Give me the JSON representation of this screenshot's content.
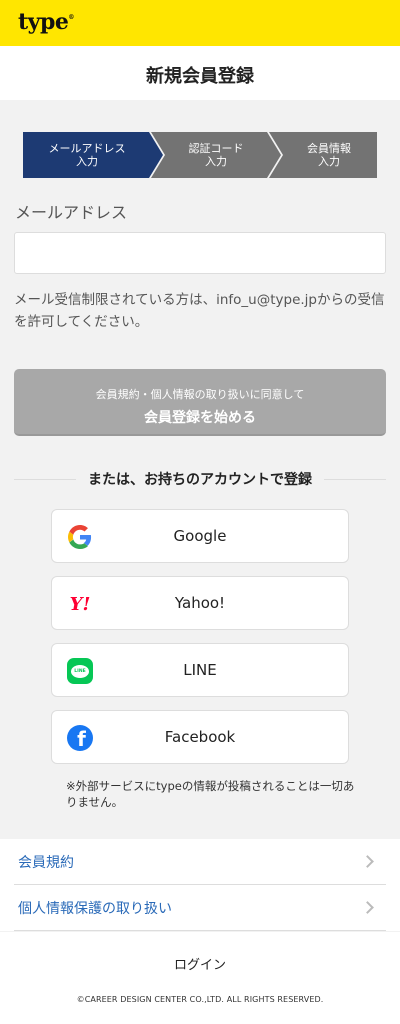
{
  "header": {
    "logo": "type",
    "logo_mark": "®"
  },
  "page": {
    "title": "新規会員登録"
  },
  "steps": [
    {
      "label": "メールアドレス\n入力",
      "active": true
    },
    {
      "label": "認証コード\n入力",
      "active": false
    },
    {
      "label": "会員情報\n入力",
      "active": false
    }
  ],
  "form": {
    "email_label": "メールアドレス",
    "email_value": "",
    "email_placeholder": "",
    "note": "メール受信制限されている方は、info_u@type.jpからの受信を許可してください。",
    "submit_small": "会員規約・個人情報の取り扱いに同意して",
    "submit_big": "会員登録を始める"
  },
  "social": {
    "divider": "または、お持ちのアカウントで登録",
    "providers": [
      {
        "label": "Google",
        "icon": "google-icon"
      },
      {
        "label": "Yahoo!",
        "icon": "yahoo-icon",
        "mark": "Y!"
      },
      {
        "label": "LINE",
        "icon": "line-icon",
        "mark": "LINE"
      },
      {
        "label": "Facebook",
        "icon": "facebook-icon",
        "mark": "f"
      }
    ],
    "disclaimer": "※外部サービスにtypeの情報が投稿されることは一切ありません。"
  },
  "links": [
    {
      "label": "会員規約"
    },
    {
      "label": "個人情報保護の取り扱い"
    }
  ],
  "footer": {
    "login": "ログイン",
    "copyright": "©CAREER DESIGN CENTER CO.,LTD. ALL RIGHTS RESERVED."
  },
  "colors": {
    "brand_yellow": "#ffe600",
    "step_active": "#1d3a73",
    "step_inactive": "#737373",
    "link_blue": "#2a6ab8"
  }
}
